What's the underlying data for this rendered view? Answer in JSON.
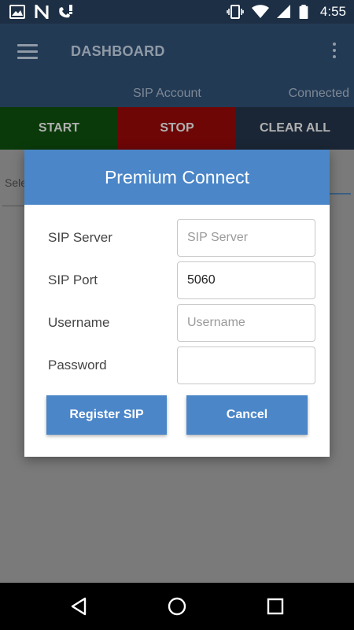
{
  "status_bar": {
    "time": "4:55",
    "left_icons": [
      "image-icon",
      "n-app-icon",
      "phone-alert-icon"
    ],
    "right_icons": [
      "vibrate-icon",
      "wifi-icon",
      "signal-icon",
      "battery-icon"
    ]
  },
  "app_bar": {
    "title": "DASHBOARD",
    "sip_account_label": "SIP Account",
    "connection_status": "Connected"
  },
  "action_buttons": {
    "start": "START",
    "stop": "STOP",
    "clear_all": "CLEAR ALL"
  },
  "background": {
    "select_label": "Sele"
  },
  "dialog": {
    "title": "Premium Connect",
    "fields": [
      {
        "label": "SIP Server",
        "value": "",
        "placeholder": "SIP Server"
      },
      {
        "label": "SIP Port",
        "value": "5060",
        "placeholder": ""
      },
      {
        "label": "Username",
        "value": "",
        "placeholder": "Username"
      },
      {
        "label": "Password",
        "value": "",
        "placeholder": ""
      }
    ],
    "register_label": "Register SIP",
    "cancel_label": "Cancel"
  },
  "colors": {
    "dialog_header": "#4a86c8",
    "button": "#4a86c8",
    "start": "#0a3a0a",
    "stop": "#6e0606",
    "clear_all": "#1a2635"
  }
}
